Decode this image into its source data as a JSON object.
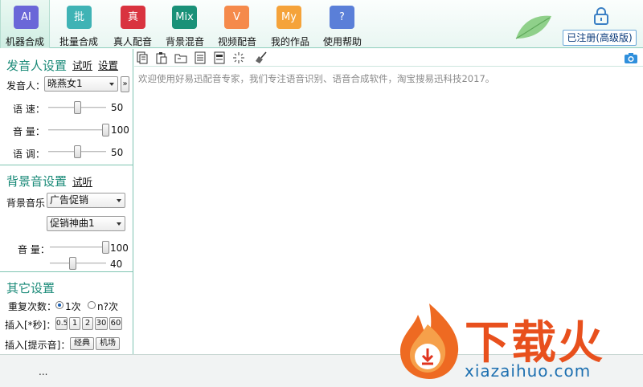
{
  "toolbar": {
    "items": [
      {
        "icon": "AI",
        "label": "机器合成",
        "color": "#6a67d8"
      },
      {
        "icon": "批",
        "label": "批量合成",
        "color": "#3fb3b5"
      },
      {
        "icon": "真",
        "label": "真人配音",
        "color": "#d9333f"
      },
      {
        "icon": "Mix",
        "label": "背景混音",
        "color": "#1a9178"
      },
      {
        "icon": "V",
        "label": "视频配音",
        "color": "#f58a4b"
      },
      {
        "icon": "My",
        "label": "我的作品",
        "color": "#f5a33a"
      },
      {
        "icon": "?",
        "label": "使用帮助",
        "color": "#5a7fd8"
      }
    ],
    "register_label": "已注册(高级版)"
  },
  "voice": {
    "title": "发音人设置",
    "preview": "试听",
    "settings": "设置",
    "speaker_label": "发音人：",
    "speaker_value": "晓燕女1",
    "speed_label": "语 速：",
    "speed_value": "50",
    "speed_level": 0.5,
    "volume_label": "音 量：",
    "volume_value": "100",
    "volume_level": 1.0,
    "pitch_label": "语 调：",
    "pitch_value": "50",
    "pitch_level": 0.5
  },
  "bgm": {
    "title": "背景音设置",
    "preview": "试听",
    "music_label": "背景音乐",
    "category_value": "广告促销",
    "track_value": "促销神曲1",
    "volume_label": "音 量：",
    "volume_value": "100",
    "volume_level": 1.0,
    "volume2_value": "40",
    "volume2_level": 0.4
  },
  "other": {
    "title": "其它设置",
    "repeat_label": "重复次数：",
    "repeat_once": "1次",
    "repeat_n": "n?次",
    "insert_sec_label": "插入[*秒]：",
    "insert_sec_buttons": [
      "0.5",
      "1",
      "2",
      "30",
      "60"
    ],
    "insert_tone_label": "插入[提示音]：",
    "tone_buttons": [
      "经典",
      "机场"
    ]
  },
  "editor": {
    "placeholder": "欢迎使用好易迅配音专家，我们专注语音识别、语音合成软件，淘宝搜易迅科技2017。"
  },
  "status": {
    "dots": "..."
  },
  "watermark": {
    "big": "下载火",
    "small": "xiazaihuo.com"
  }
}
